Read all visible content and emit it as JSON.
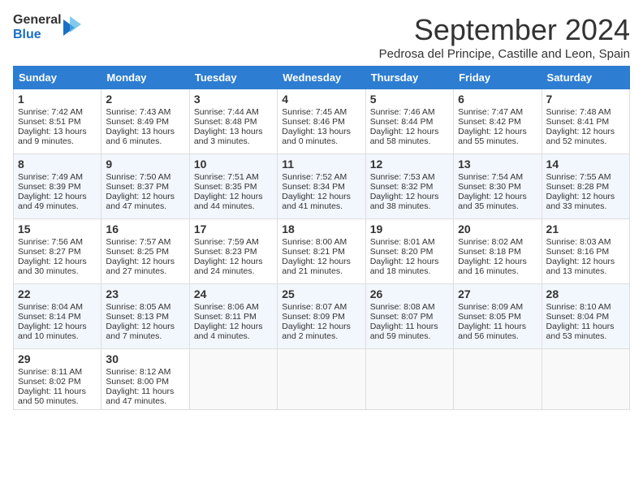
{
  "header": {
    "logo_line1": "General",
    "logo_line2": "Blue",
    "month_year": "September 2024",
    "location": "Pedrosa del Principe, Castille and Leon, Spain"
  },
  "days_of_week": [
    "Sunday",
    "Monday",
    "Tuesday",
    "Wednesday",
    "Thursday",
    "Friday",
    "Saturday"
  ],
  "weeks": [
    [
      {
        "day": "1",
        "sunrise": "Sunrise: 7:42 AM",
        "sunset": "Sunset: 8:51 PM",
        "daylight": "Daylight: 13 hours and 9 minutes."
      },
      {
        "day": "2",
        "sunrise": "Sunrise: 7:43 AM",
        "sunset": "Sunset: 8:49 PM",
        "daylight": "Daylight: 13 hours and 6 minutes."
      },
      {
        "day": "3",
        "sunrise": "Sunrise: 7:44 AM",
        "sunset": "Sunset: 8:48 PM",
        "daylight": "Daylight: 13 hours and 3 minutes."
      },
      {
        "day": "4",
        "sunrise": "Sunrise: 7:45 AM",
        "sunset": "Sunset: 8:46 PM",
        "daylight": "Daylight: 13 hours and 0 minutes."
      },
      {
        "day": "5",
        "sunrise": "Sunrise: 7:46 AM",
        "sunset": "Sunset: 8:44 PM",
        "daylight": "Daylight: 12 hours and 58 minutes."
      },
      {
        "day": "6",
        "sunrise": "Sunrise: 7:47 AM",
        "sunset": "Sunset: 8:42 PM",
        "daylight": "Daylight: 12 hours and 55 minutes."
      },
      {
        "day": "7",
        "sunrise": "Sunrise: 7:48 AM",
        "sunset": "Sunset: 8:41 PM",
        "daylight": "Daylight: 12 hours and 52 minutes."
      }
    ],
    [
      {
        "day": "8",
        "sunrise": "Sunrise: 7:49 AM",
        "sunset": "Sunset: 8:39 PM",
        "daylight": "Daylight: 12 hours and 49 minutes."
      },
      {
        "day": "9",
        "sunrise": "Sunrise: 7:50 AM",
        "sunset": "Sunset: 8:37 PM",
        "daylight": "Daylight: 12 hours and 47 minutes."
      },
      {
        "day": "10",
        "sunrise": "Sunrise: 7:51 AM",
        "sunset": "Sunset: 8:35 PM",
        "daylight": "Daylight: 12 hours and 44 minutes."
      },
      {
        "day": "11",
        "sunrise": "Sunrise: 7:52 AM",
        "sunset": "Sunset: 8:34 PM",
        "daylight": "Daylight: 12 hours and 41 minutes."
      },
      {
        "day": "12",
        "sunrise": "Sunrise: 7:53 AM",
        "sunset": "Sunset: 8:32 PM",
        "daylight": "Daylight: 12 hours and 38 minutes."
      },
      {
        "day": "13",
        "sunrise": "Sunrise: 7:54 AM",
        "sunset": "Sunset: 8:30 PM",
        "daylight": "Daylight: 12 hours and 35 minutes."
      },
      {
        "day": "14",
        "sunrise": "Sunrise: 7:55 AM",
        "sunset": "Sunset: 8:28 PM",
        "daylight": "Daylight: 12 hours and 33 minutes."
      }
    ],
    [
      {
        "day": "15",
        "sunrise": "Sunrise: 7:56 AM",
        "sunset": "Sunset: 8:27 PM",
        "daylight": "Daylight: 12 hours and 30 minutes."
      },
      {
        "day": "16",
        "sunrise": "Sunrise: 7:57 AM",
        "sunset": "Sunset: 8:25 PM",
        "daylight": "Daylight: 12 hours and 27 minutes."
      },
      {
        "day": "17",
        "sunrise": "Sunrise: 7:59 AM",
        "sunset": "Sunset: 8:23 PM",
        "daylight": "Daylight: 12 hours and 24 minutes."
      },
      {
        "day": "18",
        "sunrise": "Sunrise: 8:00 AM",
        "sunset": "Sunset: 8:21 PM",
        "daylight": "Daylight: 12 hours and 21 minutes."
      },
      {
        "day": "19",
        "sunrise": "Sunrise: 8:01 AM",
        "sunset": "Sunset: 8:20 PM",
        "daylight": "Daylight: 12 hours and 18 minutes."
      },
      {
        "day": "20",
        "sunrise": "Sunrise: 8:02 AM",
        "sunset": "Sunset: 8:18 PM",
        "daylight": "Daylight: 12 hours and 16 minutes."
      },
      {
        "day": "21",
        "sunrise": "Sunrise: 8:03 AM",
        "sunset": "Sunset: 8:16 PM",
        "daylight": "Daylight: 12 hours and 13 minutes."
      }
    ],
    [
      {
        "day": "22",
        "sunrise": "Sunrise: 8:04 AM",
        "sunset": "Sunset: 8:14 PM",
        "daylight": "Daylight: 12 hours and 10 minutes."
      },
      {
        "day": "23",
        "sunrise": "Sunrise: 8:05 AM",
        "sunset": "Sunset: 8:13 PM",
        "daylight": "Daylight: 12 hours and 7 minutes."
      },
      {
        "day": "24",
        "sunrise": "Sunrise: 8:06 AM",
        "sunset": "Sunset: 8:11 PM",
        "daylight": "Daylight: 12 hours and 4 minutes."
      },
      {
        "day": "25",
        "sunrise": "Sunrise: 8:07 AM",
        "sunset": "Sunset: 8:09 PM",
        "daylight": "Daylight: 12 hours and 2 minutes."
      },
      {
        "day": "26",
        "sunrise": "Sunrise: 8:08 AM",
        "sunset": "Sunset: 8:07 PM",
        "daylight": "Daylight: 11 hours and 59 minutes."
      },
      {
        "day": "27",
        "sunrise": "Sunrise: 8:09 AM",
        "sunset": "Sunset: 8:05 PM",
        "daylight": "Daylight: 11 hours and 56 minutes."
      },
      {
        "day": "28",
        "sunrise": "Sunrise: 8:10 AM",
        "sunset": "Sunset: 8:04 PM",
        "daylight": "Daylight: 11 hours and 53 minutes."
      }
    ],
    [
      {
        "day": "29",
        "sunrise": "Sunrise: 8:11 AM",
        "sunset": "Sunset: 8:02 PM",
        "daylight": "Daylight: 11 hours and 50 minutes."
      },
      {
        "day": "30",
        "sunrise": "Sunrise: 8:12 AM",
        "sunset": "Sunset: 8:00 PM",
        "daylight": "Daylight: 11 hours and 47 minutes."
      },
      null,
      null,
      null,
      null,
      null
    ]
  ]
}
